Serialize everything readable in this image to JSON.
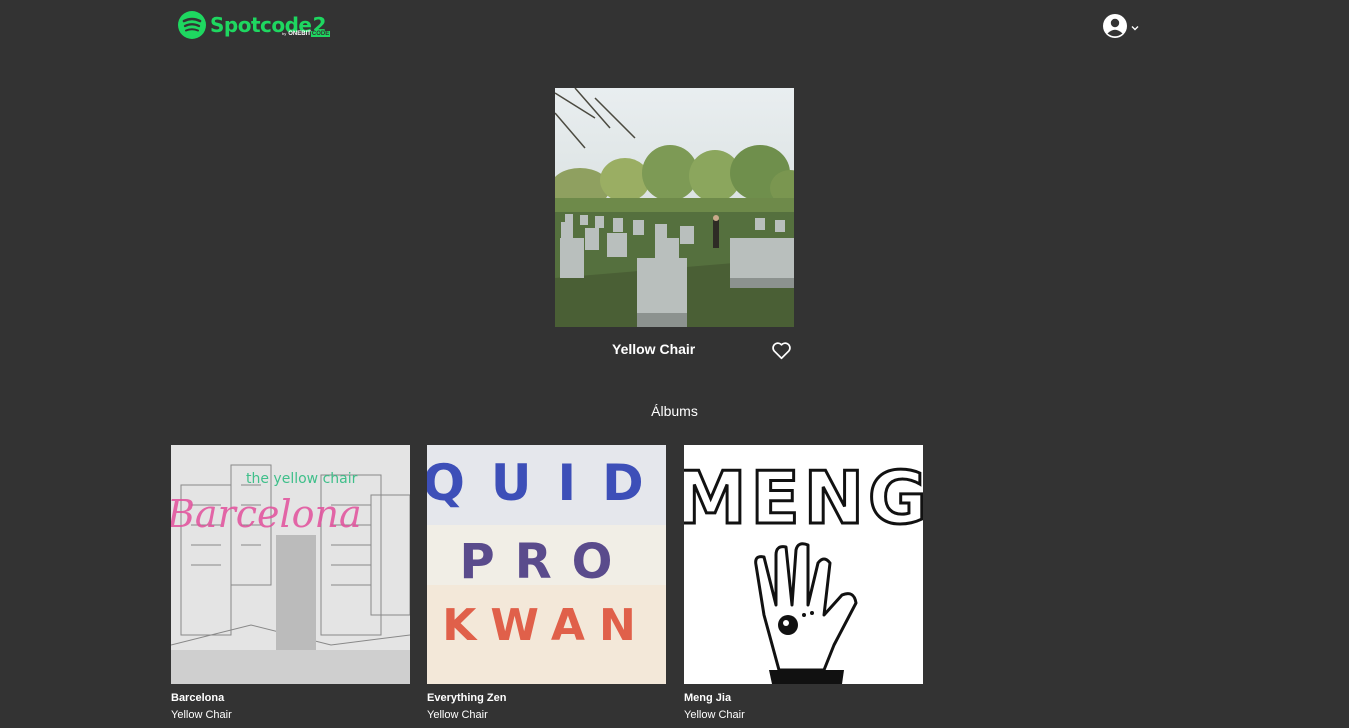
{
  "header": {
    "logo_text": "Spotcode",
    "logo_version": "2",
    "logo_by": "by",
    "logo_onebit": "ONEBIT",
    "logo_code": "CODE"
  },
  "artist": {
    "name": "Yellow Chair"
  },
  "albums_section": {
    "title": "Álbums"
  },
  "albums": [
    {
      "title": "Barcelona",
      "artist": "Yellow Chair",
      "cover_text": "Barcelona",
      "cover_band": "the yellow chair"
    },
    {
      "title": "Everything Zen",
      "artist": "Yellow Chair",
      "cover_lines": [
        "QUID",
        "PRO",
        "KWAN"
      ]
    },
    {
      "title": "Meng Jia",
      "artist": "Yellow Chair",
      "cover_text": "MENG"
    }
  ],
  "colors": {
    "background": "#333333",
    "brand": "#1ed760",
    "text": "#ffffff"
  }
}
